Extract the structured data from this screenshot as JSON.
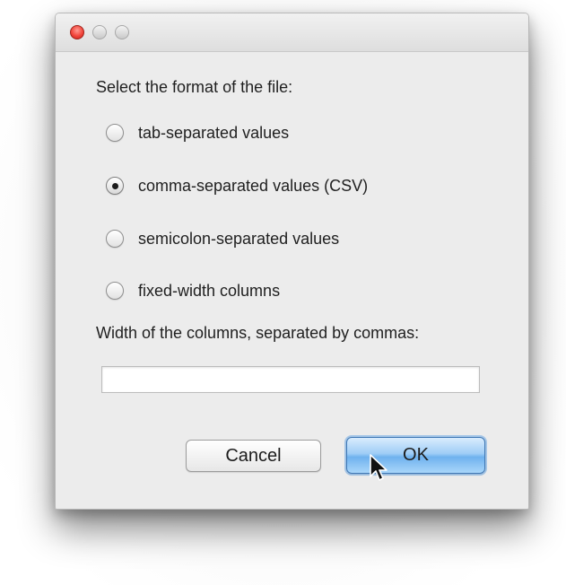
{
  "dialog": {
    "prompt": "Select the format of the file:",
    "options": [
      {
        "label": "tab-separated values",
        "selected": false
      },
      {
        "label": "comma-separated values (CSV)",
        "selected": true
      },
      {
        "label": "semicolon-separated values",
        "selected": false
      },
      {
        "label": "fixed-width columns",
        "selected": false
      }
    ],
    "width_label": "Width of the columns, separated by commas:",
    "width_value": "",
    "cancel_label": "Cancel",
    "ok_label": "OK"
  },
  "colors": {
    "accent": "#6fb2ee",
    "close_button": "#f2463c"
  },
  "icons": [
    "close-window-icon",
    "minimize-window-icon",
    "zoom-window-icon",
    "mouse-pointer-icon"
  ]
}
